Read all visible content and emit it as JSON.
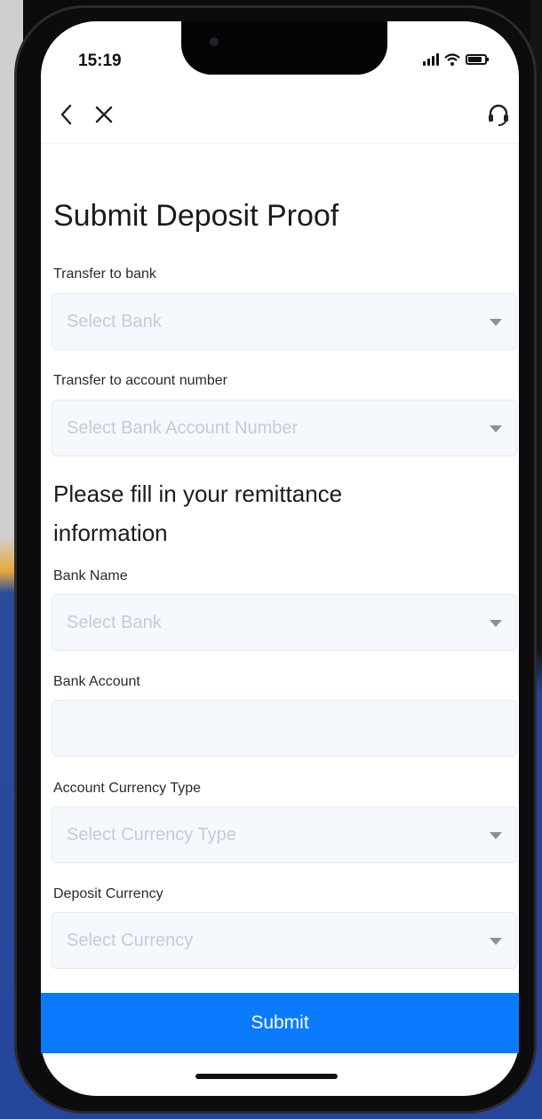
{
  "status_bar": {
    "time": "15:19",
    "icons": [
      "signal-icon",
      "wifi-icon",
      "battery-icon"
    ]
  },
  "nav": {
    "icons": [
      "back-chevron-icon",
      "close-icon",
      "headset-support-icon"
    ]
  },
  "page": {
    "title": "Submit Deposit Proof"
  },
  "transfer_section": {
    "bank_label": "Transfer to bank",
    "bank_placeholder": "Select Bank",
    "account_label": "Transfer to account number",
    "account_placeholder": "Select Bank Account Number"
  },
  "remittance_section": {
    "heading": "Please fill in your remittance information",
    "bank_name_label": "Bank Name",
    "bank_name_placeholder": "Select Bank",
    "bank_account_label": "Bank Account",
    "bank_account_value": "",
    "currency_type_label": "Account Currency Type",
    "currency_type_placeholder": "Select Currency Type",
    "deposit_currency_label": "Deposit Currency",
    "deposit_currency_placeholder": "Select Currency"
  },
  "actions": {
    "submit_label": "Submit"
  },
  "colors": {
    "primary": "#0a7bff",
    "field_bg": "#f5f8fc",
    "placeholder": "#c4ccd8",
    "text": "#1b1b1f"
  }
}
